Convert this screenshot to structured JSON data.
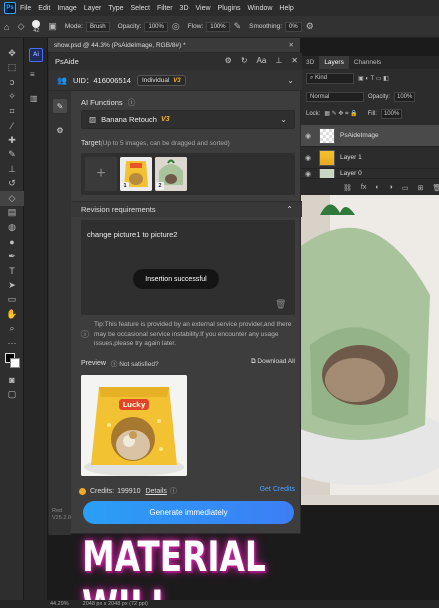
{
  "menubar": {
    "items": [
      "File",
      "Edit",
      "Image",
      "Layer",
      "Type",
      "Select",
      "Filter",
      "3D",
      "View",
      "Plugins",
      "Window",
      "Help"
    ]
  },
  "options": {
    "size": "42",
    "mode_label": "Mode:",
    "mode_value": "Brush",
    "opacity_label": "Opacity:",
    "opacity_value": "100%",
    "flow_label": "Flow:",
    "flow_value": "100%",
    "smoothing_label": "Smoothing:",
    "smoothing_value": "0%"
  },
  "document": {
    "tab_title": "show.psd @ 44.3% (PsAideImage, RGB/8#) *"
  },
  "layers_panel": {
    "tabs": [
      "3D",
      "Layers",
      "Channels"
    ],
    "kind_label": "Kind",
    "blend_mode": "Normal",
    "opacity_label": "Opacity:",
    "opacity_value": "100%",
    "lock_label": "Lock:",
    "fill_label": "Fill:",
    "fill_value": "100%",
    "layers": [
      "PsAideImage",
      "Layer 1",
      "Layer 0"
    ]
  },
  "plugin": {
    "title": "PsAide",
    "uid": "UID：416006514",
    "plan": "Individual",
    "plan_badge": "V3",
    "ai_functions_label": "AI Functions",
    "model": "Banana Retouch",
    "model_badge": "V3",
    "target_label": "Target",
    "target_hint": "(Up to 5 images, can be dragged and sorted)",
    "target_numbers": [
      "1",
      "2"
    ],
    "revision_label": "Revision requirements",
    "revision_text": "change picture1 to picture2",
    "toast": "Insertion successful",
    "tip": "Tip:This feature is provided by an external service provider,and there may be occasional service instability.If you encounter any usage issues,please try again later.",
    "preview_label": "Preview",
    "not_satisfied": "Not satisfied?",
    "download_all": "Download All",
    "credits_label": "Credits:",
    "credits_value": "199910",
    "details": "Details",
    "get_credits": "Get Credits",
    "generate": "Generate immediately",
    "preview_brand": "Lucky"
  },
  "overlay": {
    "caption": "MATERIAL WILL"
  },
  "status": {
    "zoom": "44.29%",
    "dims": "2048 px x 2048 px (72 ppi)",
    "version_line1": "Red",
    "version_line2": "V25.2.0"
  },
  "colors": {
    "accent_blue": "#3c8ef5",
    "badge_gold": "#f5b52e",
    "ps_blue": "#31a8ff",
    "glow_magenta": "#d42aa5"
  }
}
